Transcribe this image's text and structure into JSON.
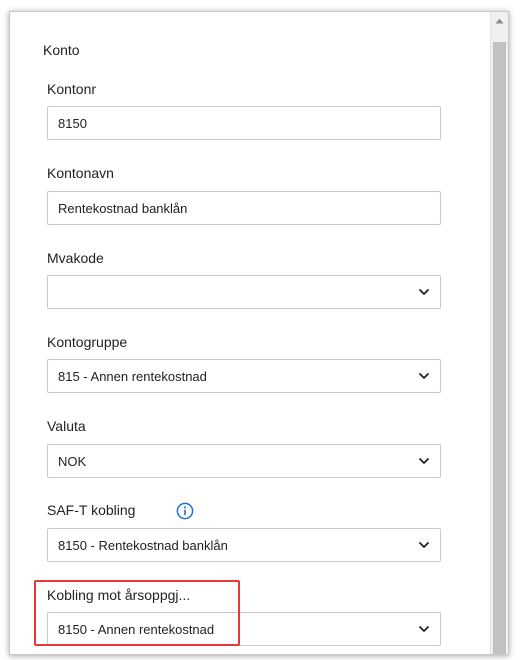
{
  "section": {
    "title": "Konto"
  },
  "fields": {
    "kontonr": {
      "label": "Kontonr",
      "value": "8150"
    },
    "kontonavn": {
      "label": "Kontonavn",
      "value": "Rentekostnad banklån"
    },
    "mvakode": {
      "label": "Mvakode",
      "value": ""
    },
    "kontogruppe": {
      "label": "Kontogruppe",
      "value": "815 - Annen rentekostnad"
    },
    "valuta": {
      "label": "Valuta",
      "value": "NOK"
    },
    "saft": {
      "label": "SAF-T kobling",
      "value": "8150 - Rentekostnad banklån"
    },
    "arsoppgjor": {
      "label": "Kobling mot årsoppgj...",
      "value": "8150 - Annen rentekostnad"
    }
  },
  "icons": {
    "info": "info-icon",
    "chevron": "chevron-down-icon",
    "scroll_up": "scroll-up-arrow-icon"
  },
  "colors": {
    "highlight": "#e53935",
    "info_icon": "#1f6fd1",
    "scroll_thumb": "#c1c1c1"
  }
}
